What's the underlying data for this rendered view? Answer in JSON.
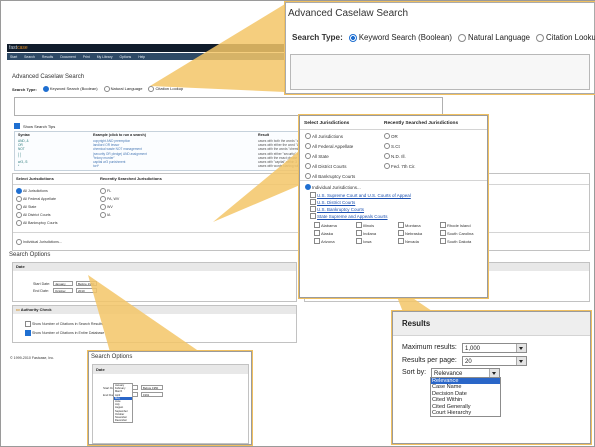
{
  "app": {
    "logo_prefix": "fast",
    "logo_suffix": "case",
    "nav": [
      "Start",
      "Search",
      "Results",
      "Document",
      "Print",
      "My Library",
      "Options",
      "Help"
    ]
  },
  "page": {
    "title": "Advanced Caselaw Search",
    "search_type_label": "Search Type:",
    "search_types": [
      "Keyword Search (Boolean)",
      "Natural Language",
      "Citation Lookup"
    ],
    "selected_search_type": "Keyword Search (Boolean)",
    "show_search_tips_label": "Show Search Tips",
    "syntax_headers": [
      "Syntax",
      "Example (click to run a search)",
      "Result"
    ],
    "syntax_rows": [
      {
        "syntax": "AND, &",
        "example": "copyright AND preemption",
        "result": "cases with both the words \"copyright\" and \"preemption\""
      },
      {
        "syntax": "OR",
        "example": "landlord OR lessor",
        "result": "cases with either the word \"landlord\" or \"lessor\""
      },
      {
        "syntax": "NOT",
        "example": "chemical waste NOT management",
        "result": "cases with the words \"chemical\" and \"waste\" but not \"management\""
      },
      {
        "syntax": "( )",
        "example": "(security OR pledge) AND assignment",
        "result": "cases with either \"security\" or \"pledge\" and \"assignment\""
      },
      {
        "syntax": "\" \"",
        "example": "\"felony murder\"",
        "result": "cases with the exact phrase \"felony murder\""
      },
      {
        "syntax": "w/3, /3",
        "example": "capital w/3 punishment",
        "result": "cases with \"capital\" within 3 words of \"punishment\""
      },
      {
        "syntax": "*",
        "example": "tort*",
        "result": "cases with words starting with \"tort\""
      }
    ],
    "jurisdictions": {
      "select_header": "Select Jurisdictions",
      "recent_header": "Recently Searched Jurisdictions",
      "options": [
        "All Jurisdictions",
        "All Federal Appellate",
        "All State",
        "All District Courts",
        "All Bankruptcy Courts"
      ],
      "selected": "All Jurisdictions",
      "recent_base": [
        "FL",
        "PA, WV",
        "WV",
        "IA"
      ],
      "individual_label": "Individual Jurisdictions..."
    },
    "search_options_title": "Search Options",
    "date": {
      "header": "Date",
      "start_label": "Start Date:",
      "start_month": "January",
      "start_mode": "Before 1950",
      "end_label": "End Date:",
      "end_month": "October",
      "end_year": "2010"
    },
    "results": {
      "header": "Results",
      "max_label": "Maximum results:",
      "max_value": "1,000",
      "per_page_label": "Results per page:",
      "per_page_value": "20",
      "sort_label": "Sort by:",
      "sort_value": "Relevance"
    },
    "authority": {
      "header": "Authority Check",
      "options": [
        "Show Number of Citations in Search Results",
        "Show Number of Citations in Entire Database"
      ]
    },
    "copyright": "© 1999-2010 Fastcase, Inc."
  },
  "callout_search": {
    "title": "Advanced Caselaw Search",
    "search_type_label": "Search Type:",
    "options": [
      "Keyword Search (Boolean)",
      "Natural Language",
      "Citation Lookup"
    ],
    "selected": "Keyword Search (Boolean)"
  },
  "callout_jurisdictions": {
    "select_header": "Select Jurisdictions",
    "recent_header": "Recently Searched Jurisdictions",
    "options": [
      "All Jurisdictions",
      "All Federal Appellate",
      "All State",
      "All District Courts",
      "All Bankruptcy Courts"
    ],
    "recent": [
      "OR",
      "S.Ct",
      "N.D. Ill.",
      "Fed. 7th Cir."
    ],
    "individual_label": "Individual Jurisdictions...",
    "links": [
      "U.S. Supreme Court and U.S. Courts of Appeal",
      "U.S. District Courts",
      "U.S. Bankruptcy Courts",
      "State Supreme and Appeals Courts"
    ],
    "states": [
      [
        "Alabama",
        "Illinois",
        "Montana",
        "Rhode Island"
      ],
      [
        "Alaska",
        "Indiana",
        "Nebraska",
        "South Carolina"
      ],
      [
        "Arizona",
        "Iowa",
        "Nevada",
        "South Dakota"
      ]
    ]
  },
  "callout_results": {
    "header": "Results",
    "max_label": "Maximum results:",
    "max_value": "1,000",
    "per_page_label": "Results per page:",
    "per_page_value": "20",
    "sort_label": "Sort by:",
    "sort_value": "Relevance",
    "sort_options": [
      "Relevance",
      "Case Name",
      "Decision Date",
      "Cited Within",
      "Cited Generally",
      "Court Hierarchy"
    ],
    "selected_sort": "Relevance"
  },
  "callout_date": {
    "title": "Search Options",
    "header": "Date",
    "start_label": "Start Date:",
    "start_month": "January",
    "start_mode": "Before 1950",
    "end_label": "End Date:",
    "end_month": "May",
    "end_year": "1991",
    "months": [
      "January",
      "February",
      "March",
      "April",
      "May",
      "June",
      "July",
      "August",
      "September",
      "October",
      "November",
      "December"
    ],
    "selected_month": "May"
  },
  "colors": {
    "accent": "#1f6fd1",
    "nav_bg": "#2e4a66",
    "callout_wedge": "#f3c567"
  }
}
